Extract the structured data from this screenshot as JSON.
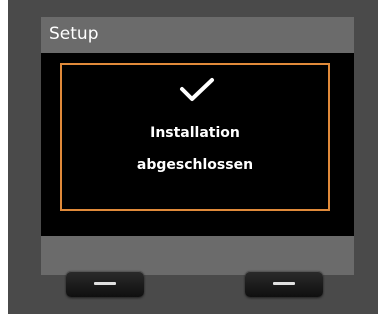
{
  "screen": {
    "title": "Setup"
  },
  "dialog": {
    "icon": "checkmark-icon",
    "message_line_1": "Installation",
    "message_line_2": "abgeschlossen"
  },
  "hardware_keys": {
    "left_icon": "dash-icon",
    "right_icon": "dash-icon"
  },
  "colors": {
    "frame": "#4a4a4a",
    "bars": "#6b6b6b",
    "dialog_border": "#e08a3a",
    "text": "#ffffff",
    "screen_bg": "#000000"
  }
}
